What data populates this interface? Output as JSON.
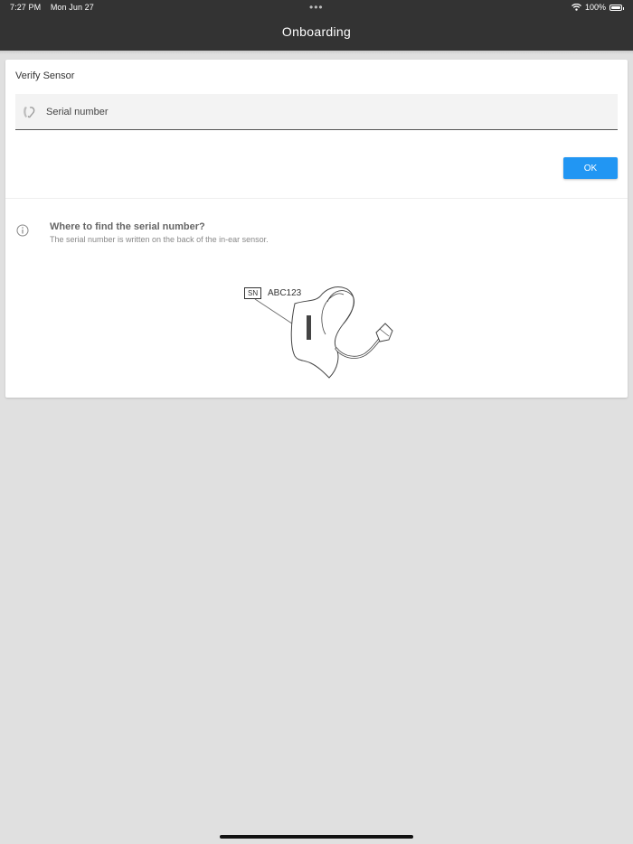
{
  "status_bar": {
    "time": "7:27 PM",
    "date": "Mon Jun 27",
    "dots": "•••",
    "battery_percent": "100%",
    "wifi_icon": "wifi-icon",
    "battery_level": 1.0
  },
  "nav": {
    "title": "Onboarding"
  },
  "verify_card": {
    "title": "Verify Sensor",
    "serial_field": {
      "placeholder": "Serial number",
      "value": "",
      "icon": "ear-sensor-icon"
    },
    "ok_label": "OK"
  },
  "info": {
    "icon": "info-icon",
    "title": "Where to find the serial number?",
    "text": "The serial number is written on the back of the in-ear sensor."
  },
  "illustration": {
    "sn_label": "SN",
    "sn_value": "ABC123"
  },
  "colors": {
    "topbar": "#333333",
    "accent": "#2196f3",
    "background": "#e0e0e0",
    "card": "#ffffff"
  }
}
